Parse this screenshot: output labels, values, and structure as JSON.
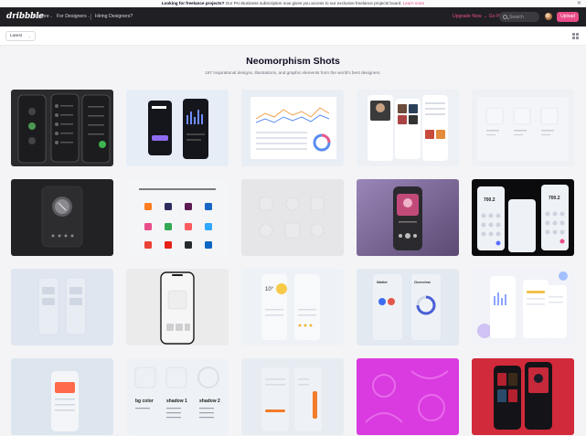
{
  "announcement": {
    "lead": "Looking for freelance projects?",
    "body": " Our Pro Business subscription now gives you access to our exclusive freelance projects board.",
    "link": "Learn more",
    "close_icon": "close-icon"
  },
  "nav": {
    "logo": "dribbble",
    "explore": "Explore",
    "for_designers": "For Designers",
    "hiring": "Hiring Designers?",
    "upgrade": "Upgrade Now → Go Pro",
    "search_placeholder": "Search",
    "upload": "Upload"
  },
  "filter": {
    "sort": "Latest",
    "view_toggle_icon": "grid-view-icon"
  },
  "page": {
    "title": "Neomorphism Shots",
    "subtitle": "197 inspirational designs, illustrations, and graphic elements from the world's best designers."
  },
  "colors": {
    "brand_pink": "#ea4c89",
    "nav_bg": "#202024",
    "page_bg": "#f4f4f6"
  },
  "shots": [
    {
      "theme": "dark-phones-call-list"
    },
    {
      "theme": "dashboard-phones-blue"
    },
    {
      "theme": "analytics-dashboard"
    },
    {
      "theme": "music-app-photos"
    },
    {
      "theme": "neumorphic-boxes-document"
    },
    {
      "theme": "dark-speaker-knob"
    },
    {
      "theme": "app-icons-grid"
    },
    {
      "theme": "neumorphic-shapes"
    },
    {
      "theme": "purple-player"
    },
    {
      "theme": "calculator-phones-dark"
    },
    {
      "theme": "light-phone-wireframes"
    },
    {
      "theme": "phone-mockup-grey"
    },
    {
      "theme": "weather-app-light"
    },
    {
      "theme": "wallet-overview"
    },
    {
      "theme": "charts-purple-phones"
    },
    {
      "theme": "orange-card-phone"
    },
    {
      "theme": "shadow-typography"
    },
    {
      "theme": "orange-slider-ui"
    },
    {
      "theme": "magenta-pattern"
    },
    {
      "theme": "spiderman-red-phones"
    }
  ],
  "shot_text": {
    "t7": "Thank that I use for work",
    "t17a": "bg color",
    "t17b": "shadow 1",
    "t17c": "shadow 2",
    "t5": "NEUM OFFICIAL",
    "t10a": "700.2",
    "t10b": "700.2",
    "t14a": "Wallet",
    "t14b": "Overview",
    "t13": "10°",
    "t4": "Josh"
  }
}
